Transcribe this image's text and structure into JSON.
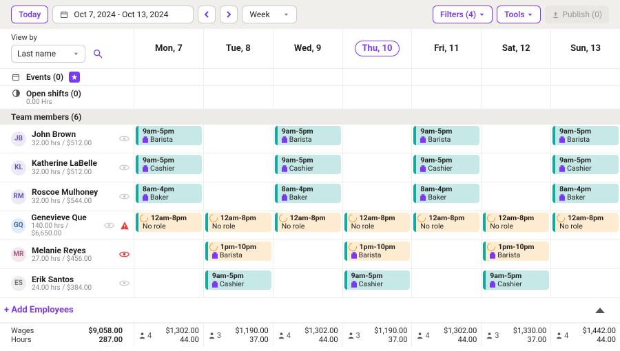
{
  "colors": {
    "accent": "#7c3aed",
    "teal": "#14a9a0",
    "warn": "#e8a33d",
    "red": "#e53935"
  },
  "toolbar": {
    "today": "Today",
    "date_range": "Oct 7, 2024 - Oct 13, 2024",
    "view_mode": "Week",
    "filters": "Filters (4)",
    "tools": "Tools",
    "publish": "Publish (0)"
  },
  "viewby": {
    "label": "View by",
    "value": "Last name"
  },
  "days": [
    {
      "label": "Mon, 7",
      "today": false
    },
    {
      "label": "Tue, 8",
      "today": false
    },
    {
      "label": "Wed, 9",
      "today": false
    },
    {
      "label": "Thu, 10",
      "today": true
    },
    {
      "label": "Fri, 11",
      "today": false
    },
    {
      "label": "Sat, 12",
      "today": false
    },
    {
      "label": "Sun, 13",
      "today": false
    }
  ],
  "events": {
    "label": "Events (0)"
  },
  "open_shifts": {
    "label": "Open shifts (0)",
    "sub": "0.00 Hrs"
  },
  "section": "Team members (6)",
  "roles": {
    "barista": {
      "label": "Barista",
      "tint": "purple"
    },
    "cashier": {
      "label": "Cashier",
      "tint": "purple"
    },
    "baker": {
      "label": "Baker",
      "tint": "purple"
    },
    "none": {
      "label": "No role",
      "tint": "gray"
    }
  },
  "employees": [
    {
      "initials": "JB",
      "avatar_bg": "#edeaf7",
      "avatar_fg": "#6b52b5",
      "name": "John Brown",
      "sub": "32.00 hrs / $512.00",
      "eye": "gray",
      "warn": false,
      "shifts": [
        {
          "day": 0,
          "time": "9am-5pm",
          "role": "barista",
          "style": "std"
        },
        null,
        {
          "day": 2,
          "time": "9am-5pm",
          "role": "barista",
          "style": "std"
        },
        null,
        {
          "day": 4,
          "time": "9am-5pm",
          "role": "barista",
          "style": "std"
        },
        null,
        {
          "day": 6,
          "time": "9am-5pm",
          "role": "barista",
          "style": "std"
        }
      ]
    },
    {
      "initials": "KL",
      "avatar_bg": "#edeaf7",
      "avatar_fg": "#6b52b5",
      "name": "Katherine LaBelle",
      "sub": "32.00 hrs / $512.00",
      "eye": "gray",
      "warn": false,
      "shifts": [
        {
          "day": 0,
          "time": "9am-5pm",
          "role": "cashier",
          "style": "std"
        },
        null,
        {
          "day": 2,
          "time": "9am-5pm",
          "role": "cashier",
          "style": "std"
        },
        null,
        {
          "day": 4,
          "time": "9am-5pm",
          "role": "cashier",
          "style": "std"
        },
        null,
        {
          "day": 6,
          "time": "9am-5pm",
          "role": "cashier",
          "style": "std"
        }
      ]
    },
    {
      "initials": "RM",
      "avatar_bg": "#edeaf7",
      "avatar_fg": "#6b52b5",
      "name": "Roscoe Mulhoney",
      "sub": "32.00 hrs / $544.00",
      "eye": "gray",
      "warn": false,
      "shifts": [
        {
          "day": 0,
          "time": "8am-4pm",
          "role": "baker",
          "style": "std"
        },
        null,
        {
          "day": 2,
          "time": "8am-4pm",
          "role": "baker",
          "style": "std"
        },
        null,
        {
          "day": 4,
          "time": "8am-4pm",
          "role": "baker",
          "style": "std"
        },
        null,
        {
          "day": 6,
          "time": "8am-4pm",
          "role": "baker",
          "style": "std"
        }
      ]
    },
    {
      "initials": "GQ",
      "avatar_bg": "#e2ecf7",
      "avatar_fg": "#3a6aa8",
      "name": "Genevieve Que",
      "sub": "140.00 hrs / $6,650.00",
      "eye": "gray",
      "warn": true,
      "shifts": [
        {
          "day": 0,
          "time": "12am-8pm",
          "role": "none",
          "style": "warn"
        },
        {
          "day": 1,
          "time": "12am-8pm",
          "role": "none",
          "style": "warn"
        },
        {
          "day": 2,
          "time": "12am-8pm",
          "role": "none",
          "style": "warn"
        },
        {
          "day": 3,
          "time": "12am-8pm",
          "role": "none",
          "style": "warn"
        },
        {
          "day": 4,
          "time": "12am-8pm",
          "role": "none",
          "style": "warn"
        },
        {
          "day": 5,
          "time": "12am-8pm",
          "role": "none",
          "style": "warn"
        },
        {
          "day": 6,
          "time": "12am-8pm",
          "role": "none",
          "style": "warn"
        }
      ]
    },
    {
      "initials": "MR",
      "avatar_bg": "#f2e8ee",
      "avatar_fg": "#a35a85",
      "name": "Melanie Reyes",
      "sub": "27.00 hrs / $456.00",
      "eye": "red",
      "warn": false,
      "shifts": [
        null,
        {
          "day": 1,
          "time": "1pm-10pm",
          "role": "barista",
          "style": "warnclock"
        },
        null,
        {
          "day": 3,
          "time": "1pm-10pm",
          "role": "barista",
          "style": "warnclock"
        },
        null,
        {
          "day": 5,
          "time": "1pm-10pm",
          "role": "barista",
          "style": "warnclock"
        },
        null
      ]
    },
    {
      "initials": "ES",
      "avatar_bg": "#eee",
      "avatar_fg": "#777",
      "name": "Erik Santos",
      "sub": "24.00 hrs / $384.00",
      "eye": "gray",
      "warn": false,
      "shifts": [
        null,
        {
          "day": 1,
          "time": "9am-5pm",
          "role": "cashier",
          "style": "std"
        },
        null,
        {
          "day": 3,
          "time": "9am-5pm",
          "role": "cashier",
          "style": "std"
        },
        null,
        {
          "day": 5,
          "time": "9am-5pm",
          "role": "cashier",
          "style": "std"
        },
        null
      ]
    }
  ],
  "add_employees": "+ Add Employees",
  "footer": {
    "labels": {
      "wages": "Wages",
      "hours": "Hours"
    },
    "totals": {
      "wages": "$9,058.00",
      "hours": "287.00"
    },
    "days": [
      {
        "people": "4",
        "wages": "$1,302.00",
        "hours": "44.00"
      },
      {
        "people": "3",
        "wages": "$1,190.00",
        "hours": "37.00"
      },
      {
        "people": "4",
        "wages": "$1,302.00",
        "hours": "44.00"
      },
      {
        "people": "3",
        "wages": "$1,190.00",
        "hours": "37.00"
      },
      {
        "people": "4",
        "wages": "$1,302.00",
        "hours": "44.00"
      },
      {
        "people": "3",
        "wages": "$1,330.00",
        "hours": "37.00"
      },
      {
        "people": "4",
        "wages": "$1,442.00",
        "hours": "44.00"
      }
    ]
  }
}
